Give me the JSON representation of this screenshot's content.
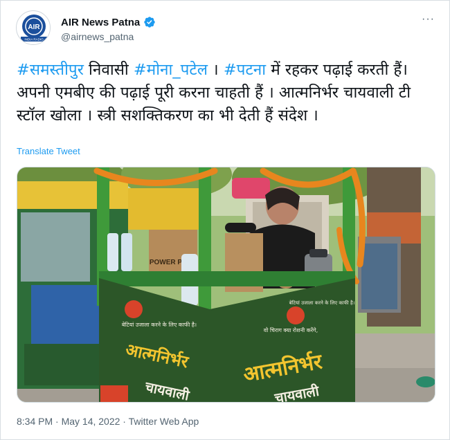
{
  "account": {
    "display_name": "AIR News Patna",
    "handle": "@airnews_patna",
    "avatar_label": "AIR",
    "avatar_subtext": "AKASHVANI",
    "avatar_band": "INDIA RADIO"
  },
  "tweet": {
    "segments": [
      {
        "text": "#समस्तीपुर",
        "type": "hashtag"
      },
      {
        "text": " निवासी ",
        "type": "text"
      },
      {
        "text": "#मोना_पटेल",
        "type": "hashtag"
      },
      {
        "text": " । ",
        "type": "text"
      },
      {
        "text": "#पटना",
        "type": "hashtag"
      },
      {
        "text": " में रहकर पढ़ाई करती हैं। अपनी एमबीए की पढ़ाई पूरी करना चाहती हैं । आत्मनिर्भर चायवाली टी स्टॉल खोला । स्त्री सशक्तिकरण का भी देती हैं संदेश ।",
        "type": "text"
      }
    ],
    "translate_label": "Translate Tweet",
    "timestamp": "8:34 PM · May 14, 2022",
    "source": "Twitter Web App",
    "separator": " · "
  },
  "photo": {
    "sign_big_text": "आत्मनिर्भर",
    "sign_sub_text": "चायवाली",
    "sign_quote_1": "वो चिराग क्या रोशनी करेंगे,",
    "sign_quote_2": "बेटियां उजाला करने के लिए काफी है।",
    "box_text": "POWER PURE",
    "colors": {
      "sign_bg": "#2c5628",
      "sign_text": "#f3c52f",
      "stall_frame": "#3f9a3a",
      "marigold": "#e8861e",
      "shirt": "#1b1b1b"
    }
  },
  "icons": {
    "verified": "verified-badge-icon",
    "more": "more-options-icon"
  }
}
